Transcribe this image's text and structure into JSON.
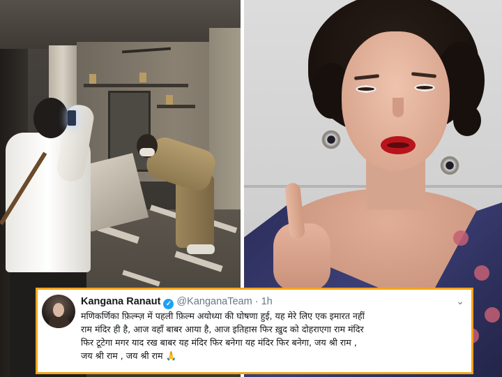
{
  "tweet": {
    "display_name": "Kangana Ranaut",
    "verified_icon": "✓",
    "handle": "@KanganaTeam",
    "separator": "·",
    "time": "1h",
    "menu_icon": "⌄",
    "lines": [
      "मणिकर्णिका फ़िल्म्ज़ में पहली फ़िल्म अयोध्या की घोषणा हुई, यह मेरे लिए एक इमारत नहीं",
      "राम मंदिर ही है, आज वहाँ बाबर आया है, आज इतिहास फिर ख़ुद को दोहराएगा राम मंदिर",
      "फिर टूटेगा मगर याद रख बाबर यह मंदिर फिर बनेगा यह मंदिर फिर बनेगा, जय श्री राम ,",
      "जय श्री राम , जय श्री राम 🙏"
    ]
  },
  "colors": {
    "card_border": "#f4a51c",
    "verified_badge": "#1da1f2",
    "muted_text": "#657786"
  }
}
